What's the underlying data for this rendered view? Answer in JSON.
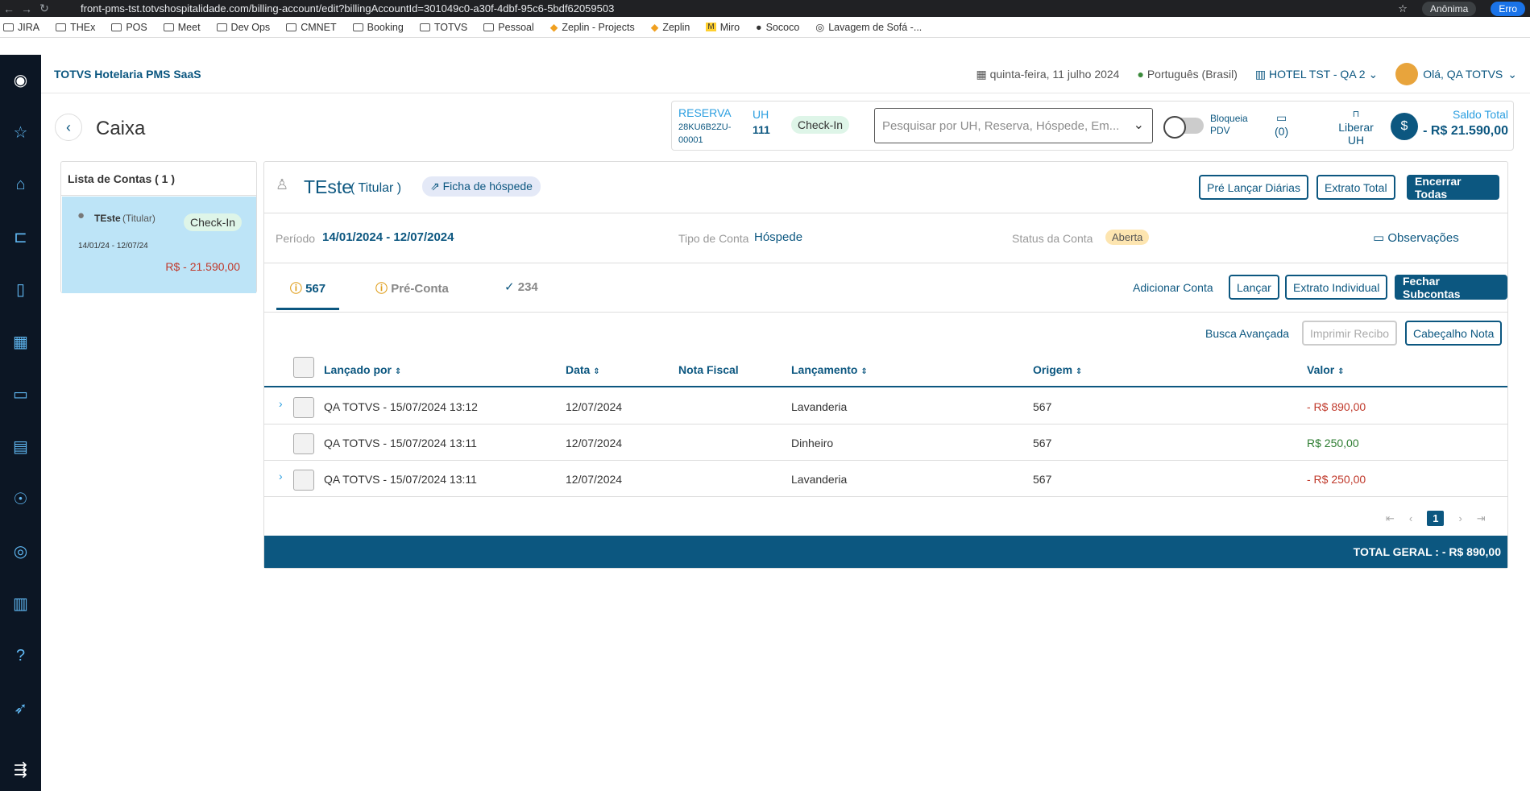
{
  "browser": {
    "url": "front-pms-tst.totvshospitalidade.com/billing-account/edit?billingAccountId=301049c0-a30f-4dbf-95c6-5bdf62059503",
    "incognito_label": "Anônima",
    "error_label": "Erro",
    "bookmarks": [
      "JIRA",
      "THEx",
      "POS",
      "Meet",
      "Dev Ops",
      "CMNET",
      "Booking",
      "TOTVS",
      "Pessoal",
      "Zeplin - Projects",
      "Zeplin",
      "Miro",
      "Sococo",
      "Lavagem de Sofá -..."
    ]
  },
  "topbar": {
    "brand": "TOTVS Hotelaria PMS SaaS",
    "date": "quinta-feira, 11 julho 2024",
    "language": "Português (Brasil)",
    "hotel": "HOTEL TST - QA 2",
    "user": "Olá, QA TOTVS"
  },
  "page": {
    "title": "Caixa",
    "reserva_label": "RESERVA",
    "reserva_code": "28KU6B2ZU-00001",
    "uh_label": "UH",
    "uh_value": "111",
    "status_chip": "Check-In",
    "search_placeholder": "Pesquisar por UH, Reserva, Hóspede, Em...",
    "bloqueia_pdv": "Bloqueia PDV",
    "messages_count": "(0)",
    "liberar_uh": "Liberar UH",
    "saldo_label": "Saldo Total",
    "saldo_value": "- R$ 21.590,00"
  },
  "left_panel": {
    "title": "Lista de Contas ( 1 )",
    "account_name": "TEste",
    "account_role": "(Titular)",
    "account_status": "Check-In",
    "account_period": "14/01/24 - 12/07/24",
    "account_amount": "R$ - 21.590,00"
  },
  "account": {
    "name": "TEste",
    "role": "( Titular )",
    "guest_sheet": "Ficha de hóspede",
    "btn_pre_lancar": "Pré Lançar Diárias",
    "btn_extrato_total": "Extrato Total",
    "btn_encerrar": "Encerrar Todas",
    "periodo_label": "Período",
    "periodo_value": "14/01/2024 - 12/07/2024",
    "tipo_label": "Tipo de Conta",
    "tipo_value": "Hóspede",
    "status_label": "Status da Conta",
    "status_value": "Aberta",
    "observacoes": "Observações"
  },
  "tabs": [
    {
      "label": "567"
    },
    {
      "label": "Pré-Conta"
    },
    {
      "label": "234"
    }
  ],
  "actions": {
    "adicionar_conta": "Adicionar Conta",
    "lancar": "Lançar",
    "extrato_individual": "Extrato Individual",
    "fechar_subcontas": "Fechar Subcontas",
    "busca_avancada": "Busca Avançada",
    "imprimir_recibo": "Imprimir Recibo",
    "cabecalho_nota": "Cabeçalho Nota"
  },
  "table": {
    "headers": [
      "Lançado por",
      "Data",
      "Nota Fiscal",
      "Lançamento",
      "Origem",
      "Valor"
    ],
    "rows": [
      {
        "lancado_por": "QA TOTVS - 15/07/2024 13:12",
        "data": "12/07/2024",
        "nota": "",
        "lancamento": "Lavanderia",
        "origem": "567",
        "valor": "- R$ 890,00"
      },
      {
        "lancado_por": "QA TOTVS - 15/07/2024 13:11",
        "data": "12/07/2024",
        "nota": "",
        "lancamento": "Dinheiro",
        "origem": "567",
        "valor": "R$ 250,00"
      },
      {
        "lancado_por": "QA TOTVS - 15/07/2024 13:11",
        "data": "12/07/2024",
        "nota": "",
        "lancamento": "Lavanderia",
        "origem": "567",
        "valor": "- R$ 250,00"
      }
    ],
    "current_page": "1",
    "total": "TOTAL GERAL : - R$ 890,00"
  }
}
